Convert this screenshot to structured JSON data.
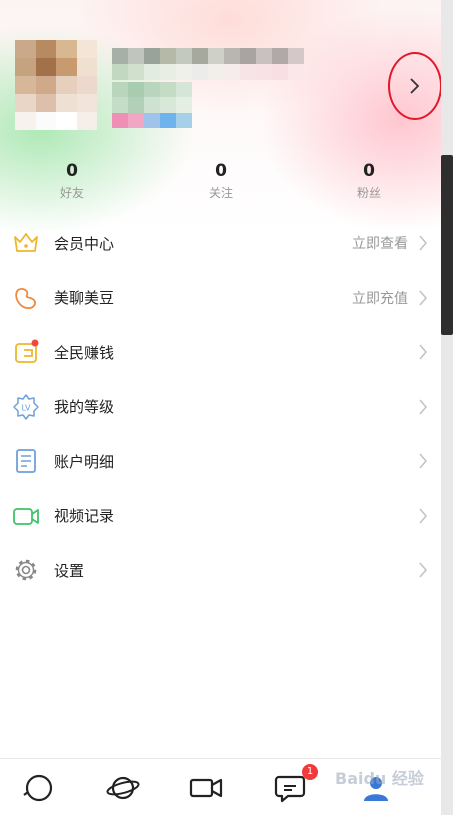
{
  "stats": [
    {
      "value": "0",
      "label": "好友"
    },
    {
      "value": "0",
      "label": "关注"
    },
    {
      "value": "0",
      "label": "粉丝"
    }
  ],
  "menu": [
    {
      "label": "会员中心",
      "value": "立即查看",
      "icon": "crown-icon"
    },
    {
      "label": "美聊美豆",
      "value": "立即充值",
      "icon": "bean-icon"
    },
    {
      "label": "全民赚钱",
      "value": "",
      "icon": "wallet-icon"
    },
    {
      "label": "我的等级",
      "value": "",
      "icon": "level-badge-icon"
    },
    {
      "label": "账户明细",
      "value": "",
      "icon": "document-icon"
    },
    {
      "label": "视频记录",
      "value": "",
      "icon": "video-camera-icon"
    },
    {
      "label": "设置",
      "value": "",
      "icon": "gear-icon"
    }
  ],
  "bottom_nav": {
    "items": [
      "home-circle-icon",
      "planet-icon",
      "video-camera-icon",
      "chat-icon",
      "profile-icon"
    ],
    "message_badge": "1"
  },
  "watermark": "Baidu 经验",
  "colors": {
    "highlight_circle": "#e0182a",
    "badge": "#f23a3a",
    "secondary_text": "#999999"
  }
}
